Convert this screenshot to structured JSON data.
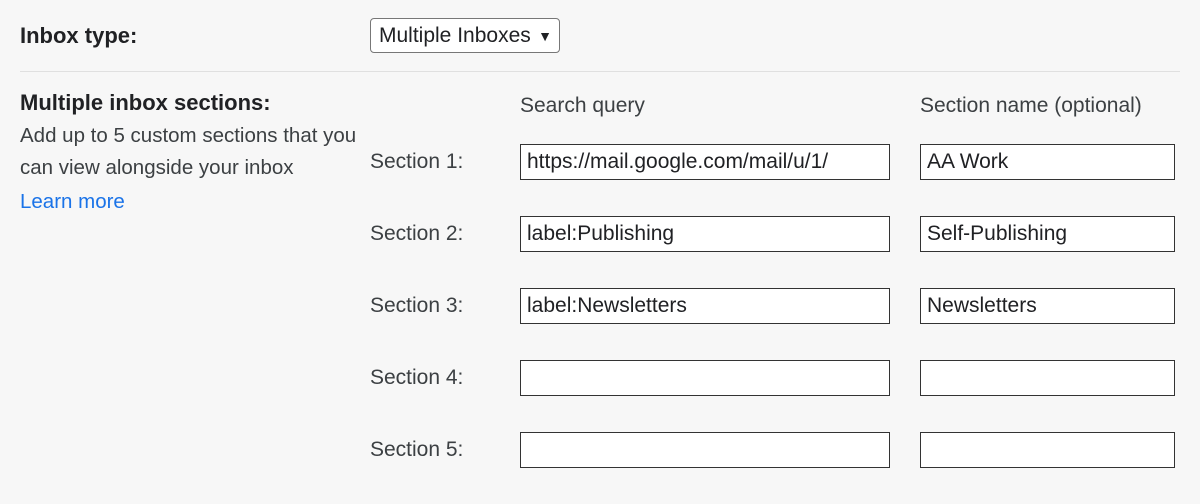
{
  "inboxType": {
    "label": "Inbox type:",
    "selected": "Multiple Inboxes"
  },
  "multipleSections": {
    "title": "Multiple inbox sections:",
    "description": "Add up to 5 custom sections that you can view alongside your inbox",
    "learnMore": "Learn more"
  },
  "headers": {
    "query": "Search query",
    "name": "Section name (optional)"
  },
  "sections": [
    {
      "label": "Section 1:",
      "query": "https://mail.google.com/mail/u/1/",
      "name": "AA Work"
    },
    {
      "label": "Section 2:",
      "query": "label:Publishing",
      "name": "Self-Publishing"
    },
    {
      "label": "Section 3:",
      "query": "label:Newsletters",
      "name": "Newsletters"
    },
    {
      "label": "Section 4:",
      "query": "",
      "name": ""
    },
    {
      "label": "Section 5:",
      "query": "",
      "name": ""
    }
  ]
}
